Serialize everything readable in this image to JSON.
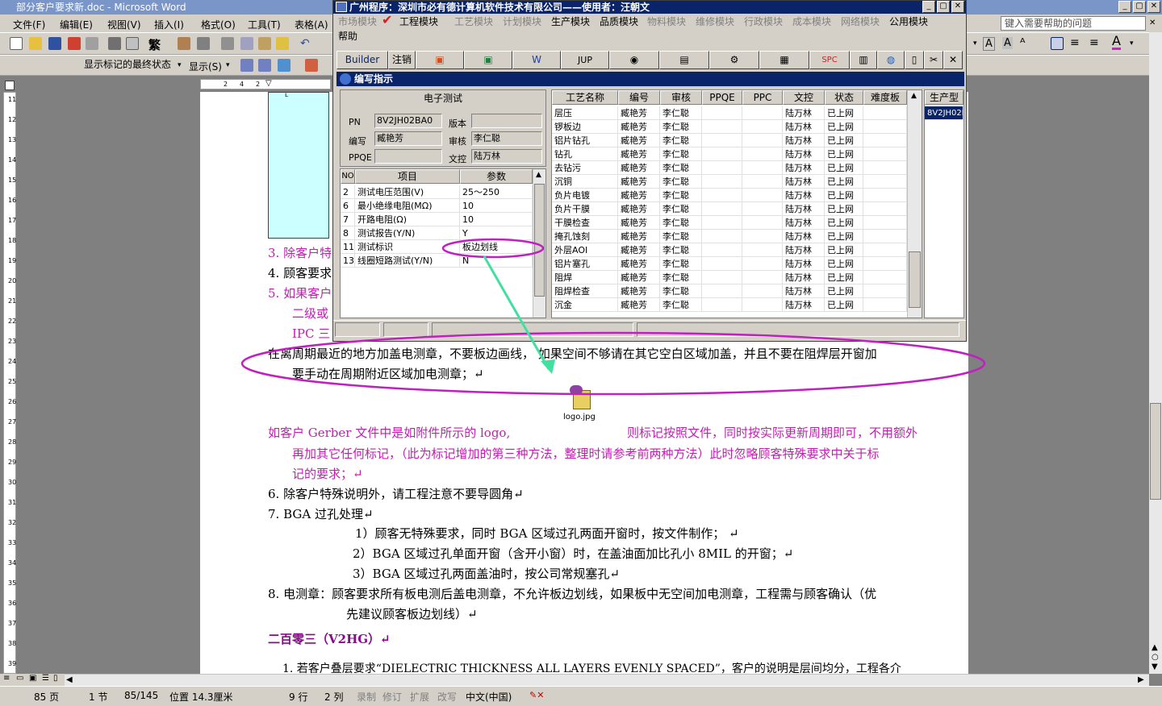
{
  "word": {
    "title": "部分客户要求新.doc - Microsoft Word",
    "menu": [
      "文件(F)",
      "编辑(E)",
      "视图(V)",
      "插入(I)",
      "格式(O)",
      "工具(T)",
      "表格(A)"
    ],
    "help_placeholder": "键入需要帮助的问题",
    "show_state": "显示标记的最终状态",
    "show_btn": "显示(S)",
    "ruler_marks": [
      "2",
      "4",
      "2"
    ],
    "vruler": [
      "11",
      "12",
      "13",
      "14",
      "15",
      "16",
      "17",
      "18",
      "19",
      "20",
      "21",
      "22",
      "23",
      "24",
      "25",
      "26",
      "27",
      "28",
      "29",
      "30",
      "31",
      "32",
      "33",
      "34",
      "35",
      "36",
      "37",
      "38",
      "39"
    ]
  },
  "doc": {
    "l1": "3. 除客户特",
    "l2": "4. 顾客要求",
    "l3": "5. 如果客户",
    "l4": "二级或",
    "l5": "IPC 三",
    "l6": "在离周期最近的地方加盖电测章，不要板边画线， 如果空间不够请在其它空白区域加盖，并且不要在阻焊层开窗加",
    "l7": "要手动在周期附近区域加电测章；↵",
    "icon_label": "logo.jpg",
    "l8a": "如客户 Gerber 文件中是如附件所示的 logo,",
    "l8b": "则标记按照文件，同时按实际更新周期即可，不用额外",
    "l9": "再加其它任何标记，（此为标记增加的第三种方法，整理时请参考前两种方法）此时忽略顾客特殊要求中关于标",
    "l10": "记的要求；↵",
    "l11": "6. 除客户特殊说明外，请工程注意不要导圆角↵",
    "l12": "7. BGA 过孔处理↵",
    "l13": "1）顾客无特殊要求，同时 BGA 区域过孔两面开窗时，按文件制作；  ↵",
    "l14": "2）BGA 区域过孔单面开窗（含开小窗）时，在盖油面加比孔小 8MIL 的开窗；↵",
    "l15": "3）BGA 区域过孔两面盖油时，按公司常规塞孔↵",
    "l16": "8. 电测章：顾客要求所有板电测后盖电测章，不允许板边划线，如果板中无空间加电测章，工程需与顾客确认（优",
    "l17": "先建议顾客板边划线）↵",
    "l18": "二百零三（V2HG）↵",
    "l19": "1.  若客户叠层要求“DIELECTRIC THICKNESS ALL LAYERS EVENLY SPACED”，客户的说明是层间均分，工程各介"
  },
  "status": {
    "page": "85 页",
    "section": "1 节",
    "pages": "85/145",
    "pos": "位置 14.3厘米",
    "row": "9 行",
    "col": "2 列",
    "rec": "录制",
    "rev": "修订",
    "ext": "扩展",
    "ovr": "改写",
    "lang": "中文(中国)"
  },
  "app": {
    "title": "广州程序：深圳市必有德计算机软件技术有限公司——使用者：汪朝文",
    "menu": [
      "市场模块",
      "工程模块",
      "工艺模块",
      "计划模块",
      "生产模块",
      "品质模块",
      "物料模块",
      "维修模块",
      "行政模块",
      "成本模块",
      "网络模块",
      "公用模块"
    ],
    "help": "帮助",
    "buttons": [
      "Builder",
      "注销",
      "JUP",
      "SPC"
    ],
    "subtitle": "编写指示",
    "group_title": "电子测试",
    "pn_label": "PN",
    "pn": "8V2JH02BA0",
    "ver_label": "版本",
    "ver": "",
    "writer_label": "编写",
    "writer": "臧艳芳",
    "review_label": "审核",
    "reviewer": "李仁聪",
    "ppqe_label": "PPQE",
    "ppqe": "",
    "doc_label": "文控",
    "doc_ctrl": "陆万林",
    "param_headers": [
      "NO",
      "项目",
      "参数"
    ],
    "params": [
      {
        "no": "2",
        "item": "测试电压范围(V)",
        "val": "25～250"
      },
      {
        "no": "6",
        "item": "最小绝缘电阻(MΩ)",
        "val": "10"
      },
      {
        "no": "7",
        "item": "开路电阻(Ω)",
        "val": "10"
      },
      {
        "no": "8",
        "item": "测试报告(Y/N)",
        "val": "Y"
      },
      {
        "no": "11",
        "item": "测试标识",
        "val": "板边划线"
      },
      {
        "no": "13",
        "item": "线圈短路测试(Y/N)",
        "val": "N"
      }
    ],
    "proc_headers": [
      "工艺名称",
      "编号",
      "审核",
      "PPQE",
      "PPC",
      "文控",
      "状态",
      "难度板"
    ],
    "procs": [
      "层压",
      "锣板边",
      "铝片钻孔",
      "钻孔",
      "去钻污",
      "沉铜",
      "负片电镀",
      "负片干膜",
      "干膜检查",
      "掩孔蚀刻",
      "外层AOI",
      "铝片塞孔",
      "阻焊",
      "阻焊检查",
      "沉金"
    ],
    "proc_writer": "臧艳芳",
    "proc_review": "李仁聪",
    "proc_doc": "陆万林",
    "proc_state": "已上网",
    "side_header": "生产型",
    "side_value": "8V2JH02B"
  }
}
